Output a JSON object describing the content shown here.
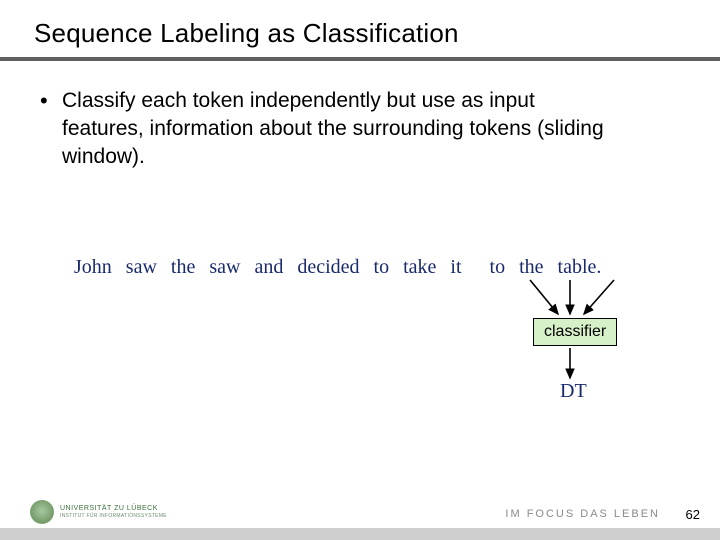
{
  "title": "Sequence Labeling as Classification",
  "bullet": "Classify each token independently but use as input features, information about the surrounding tokens (sliding window).",
  "sentence": [
    "John",
    "saw",
    "the",
    "saw",
    "and",
    "decided",
    "to",
    "take",
    "it",
    "to",
    "the",
    "table."
  ],
  "classifier_label": "classifier",
  "output_label": "DT",
  "footer": {
    "university": "UNIVERSITÄT ZU LÜBECK",
    "institute": "INSTITUT FÜR INFORMATIONSSYSTEME",
    "tagline": "IM FOCUS DAS LEBEN",
    "page": "62"
  }
}
